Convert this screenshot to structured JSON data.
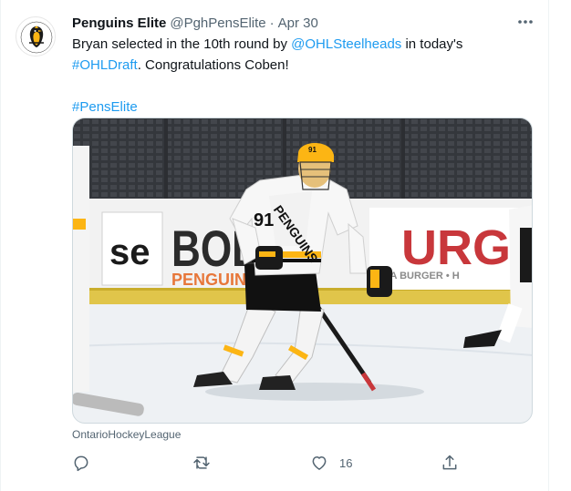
{
  "tweet": {
    "author_name": "Penguins Elite",
    "author_handle": "@PghPensElite",
    "separator": "·",
    "date": "Apr 30",
    "text_parts": {
      "pre": "Bryan selected in the 10th round by ",
      "mention": "@OHLSteelheads",
      "mid": " in today's ",
      "hashtag1": "#OHLDraft",
      "post": ". Congratulations Coben!",
      "hashtag2": "#PensElite"
    },
    "media": {
      "board_text_bold": "BOLD",
      "board_text_penguins": "PENGUINS",
      "board_text_urga": "URGA",
      "board_text_sub": "H   VA BURGER • H",
      "board_text_se": "se",
      "jersey_number": "91"
    },
    "source_label": "OntarioHockeyLeague",
    "actions": {
      "reply_icon": "reply-icon",
      "retweet_icon": "retweet-icon",
      "like_icon": "heart-icon",
      "like_count": "16",
      "share_icon": "share-icon"
    },
    "colors": {
      "link": "#1d9bf0",
      "secondary_text": "#536471",
      "primary_text": "#0f1419"
    }
  }
}
